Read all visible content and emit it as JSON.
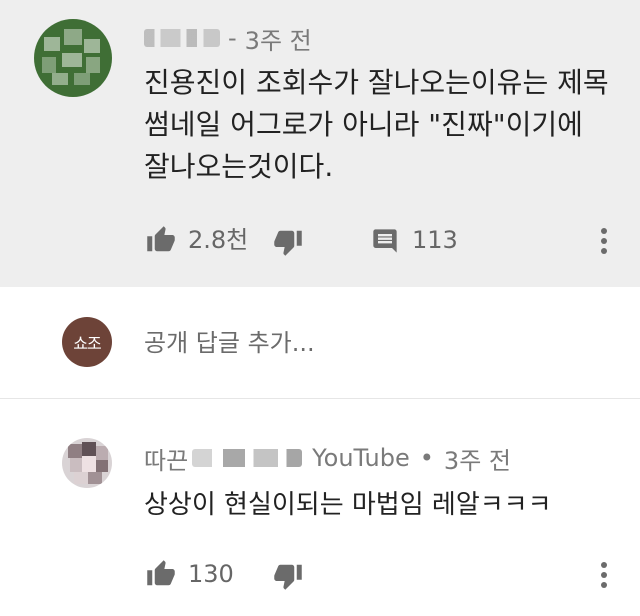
{
  "top_comment": {
    "author": "",
    "time": "3주 전",
    "text_lines": [
      "진용진이 조회수가 잘나오는이유는 제목",
      "썸네일 어그로가 아니라 \"진짜\"이기에",
      "잘나오는것이다."
    ],
    "likes": "2.8천",
    "replies": "113",
    "icons": {
      "like": "thumbs-up-icon",
      "dislike": "thumbs-down-icon",
      "reply": "reply-icon",
      "more": "more-vert-icon"
    }
  },
  "reply_bar": {
    "user_avatar_text": "쇼조",
    "placeholder": "공개 답글 추가..."
  },
  "second_comment": {
    "author_prefix": "따끈",
    "author_tag": "YouTube",
    "dot": "•",
    "time": "3주 전",
    "text": "상상이 현실이되는 마법임 레알ㅋㅋㅋ",
    "likes": "130",
    "icons": {
      "like": "thumbs-up-icon",
      "dislike": "thumbs-down-icon",
      "more": "more-vert-icon"
    }
  },
  "colors": {
    "highlight_bg": "#eeeeee",
    "top_avatar": "#3f6e35",
    "user_avatar": "#6d4338",
    "icon": "#6b6b6b",
    "text": "#222222",
    "meta": "#7a7a7a"
  }
}
